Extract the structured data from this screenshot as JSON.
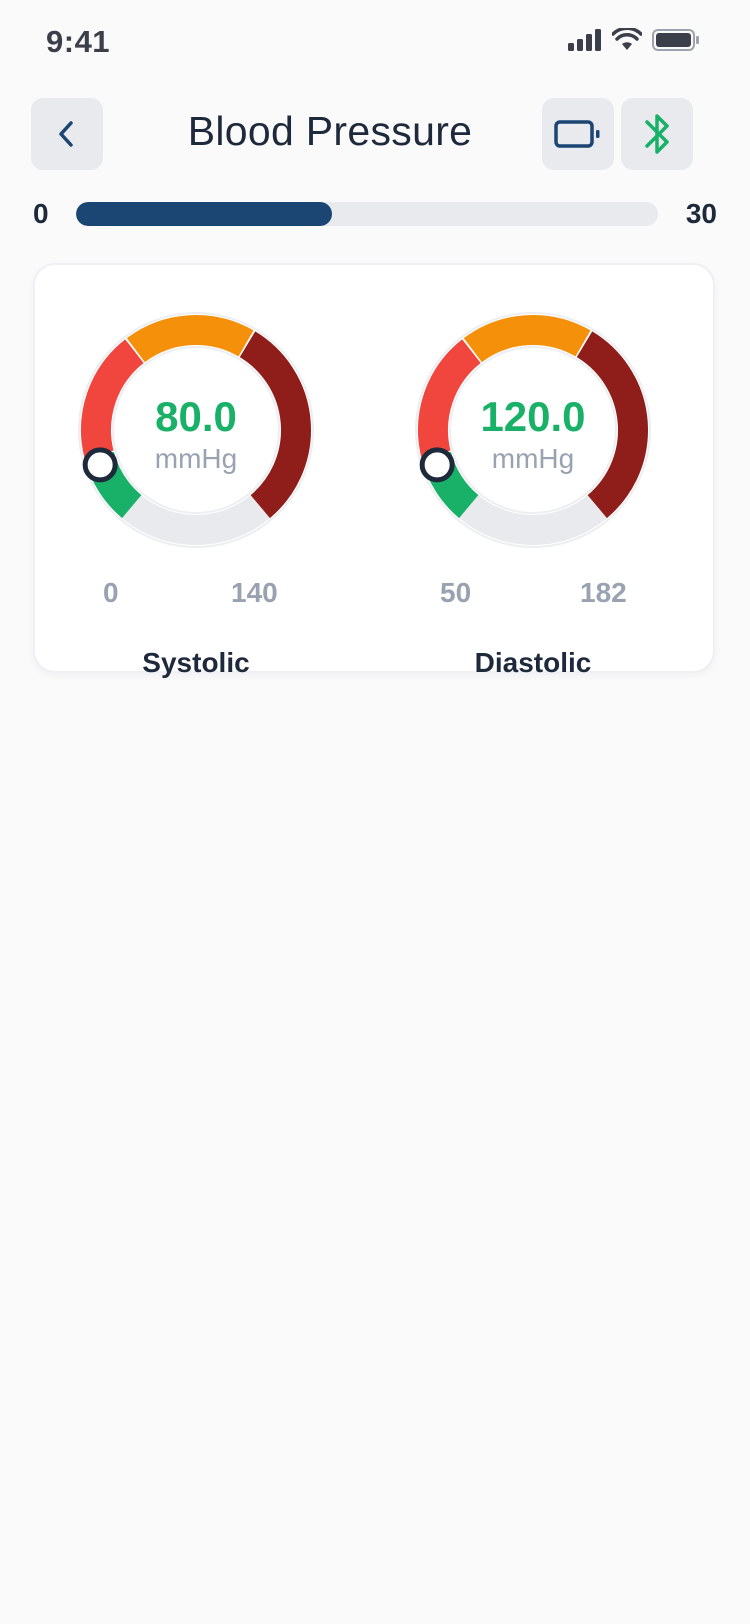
{
  "status_bar": {
    "time": "9:41"
  },
  "header": {
    "title": "Blood Pressure"
  },
  "progress": {
    "min": "0",
    "max": "30",
    "value_fraction": 0.44
  },
  "gauges": [
    {
      "name": "Systolic",
      "value": "80.0",
      "unit": "mmHg",
      "min": "0",
      "max": "140",
      "knob_fraction": 0.08
    },
    {
      "name": "Diastolic",
      "value": "120.0",
      "unit": "mmHg",
      "min": "50",
      "max": "182",
      "knob_fraction": 0.08
    }
  ],
  "colors": {
    "accent": "#1b4572",
    "green": "#18b167",
    "red": "#f0463d",
    "orange": "#f5900a",
    "dark_red": "#8f1e1a",
    "track": "#e8eaee",
    "text_dark": "#1e2a3b",
    "text_muted": "#99a2b0"
  },
  "icons": {
    "back": "chevron-left-icon",
    "device": "tablet-icon",
    "connection": "bluetooth-icon"
  }
}
